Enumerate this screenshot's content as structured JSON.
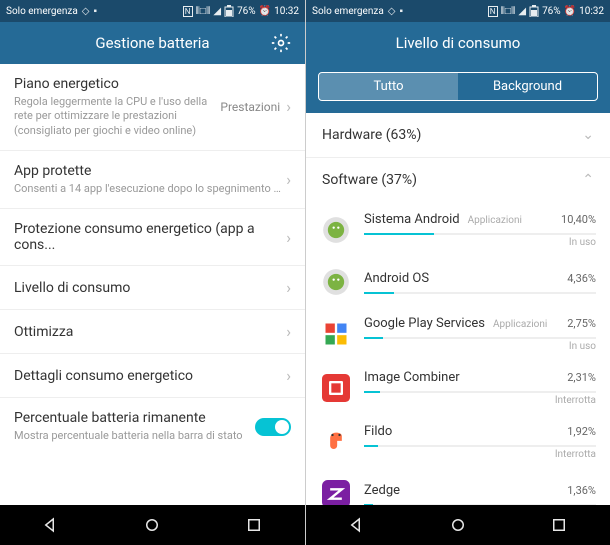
{
  "status": {
    "carrier": "Solo emergenza",
    "battery": "76%",
    "time": "10:32"
  },
  "left": {
    "title": "Gestione batteria",
    "items": [
      {
        "label": "Piano energetico",
        "sub": "Regola leggermente la CPU e l'uso della rete per ottimizzare le prestazioni (consigliato per giochi e video online)",
        "value": "Prestazioni",
        "arrow": true
      },
      {
        "label": "App protette",
        "sub": "Consenti a 14 app l'esecuzione dopo lo spegnimento dello...",
        "arrow": true
      },
      {
        "label": "Protezione consumo energetico (app a cons...",
        "arrow": true
      },
      {
        "label": "Livello di consumo",
        "arrow": true
      },
      {
        "label": "Ottimizza",
        "arrow": true
      },
      {
        "label": "Dettagli consumo energetico",
        "arrow": true
      }
    ],
    "toggle": {
      "label": "Percentuale batteria rimanente",
      "sub": "Mostra percentuale batteria nella barra di stato"
    }
  },
  "right": {
    "title": "Livello di consumo",
    "tabs": {
      "all": "Tutto",
      "bg": "Background"
    },
    "hardware": "Hardware (63%)",
    "software": "Software (37%)",
    "apps": [
      {
        "name": "Sistema Android",
        "tag": "Applicazioni",
        "pct": "10,40%",
        "status": "In uso",
        "bar": 30
      },
      {
        "name": "Android OS",
        "tag": "",
        "pct": "4,36%",
        "status": "",
        "bar": 13
      },
      {
        "name": "Google Play Services",
        "tag": "Applicazioni",
        "pct": "2,75%",
        "status": "In uso",
        "bar": 8
      },
      {
        "name": "Image Combiner",
        "tag": "",
        "pct": "2,31%",
        "status": "Interrotta",
        "bar": 7
      },
      {
        "name": "Fildo",
        "tag": "",
        "pct": "1,92%",
        "status": "Interrotta",
        "bar": 6
      },
      {
        "name": "Zedge",
        "tag": "",
        "pct": "1,36%",
        "status": "",
        "bar": 4
      }
    ]
  },
  "chart_data": {
    "type": "bar",
    "title": "Livello di consumo - Software",
    "categories": [
      "Sistema Android",
      "Android OS",
      "Google Play Services",
      "Image Combiner",
      "Fildo",
      "Zedge"
    ],
    "values": [
      10.4,
      4.36,
      2.75,
      2.31,
      1.92,
      1.36
    ],
    "groups": {
      "Hardware": 63,
      "Software": 37
    }
  }
}
